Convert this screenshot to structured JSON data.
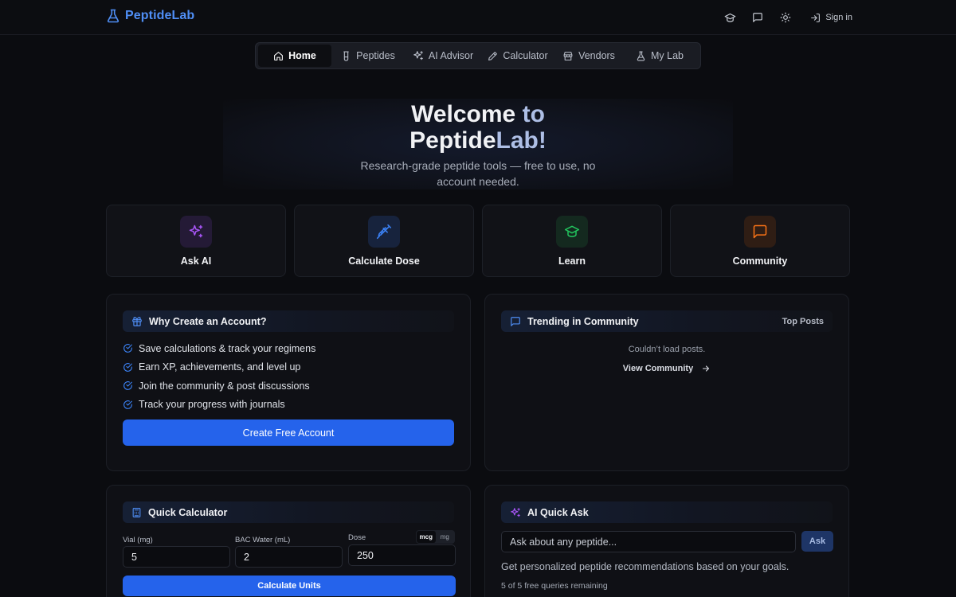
{
  "header": {
    "brand": "PeptideLab",
    "icons": [
      "learn-icon",
      "community-icon",
      "theme-icon"
    ],
    "signin_label": "Sign in"
  },
  "nav": {
    "items": [
      {
        "label": "Home",
        "icon": "home-icon",
        "active": true
      },
      {
        "label": "Peptides",
        "icon": "vial-icon",
        "active": false
      },
      {
        "label": "AI Advisor",
        "icon": "sparkles-icon",
        "active": false
      },
      {
        "label": "Calculator",
        "icon": "pen-icon",
        "active": false
      },
      {
        "label": "Vendors",
        "icon": "store-icon",
        "active": false
      },
      {
        "label": "My Lab",
        "icon": "flask-icon",
        "active": false
      }
    ]
  },
  "hero": {
    "title_prefix": "Welcome",
    "title_to": " to",
    "title_brand_a": "Peptide",
    "title_brand_b": "Lab!",
    "subtitle": "Research-grade peptide tools — free to use, no account needed."
  },
  "quick_actions": [
    {
      "label": "Ask AI",
      "icon": "sparkles-icon",
      "color": "#a855f7"
    },
    {
      "label": "Calculate Dose",
      "icon": "syringe-icon",
      "color": "#3b82f6"
    },
    {
      "label": "Learn",
      "icon": "graduation-cap-icon",
      "color": "#22c55e"
    },
    {
      "label": "Community",
      "icon": "message-icon",
      "color": "#f97316"
    }
  ],
  "account_panel": {
    "title": "Why Create an Account?",
    "benefits": [
      "Save calculations & track your regimens",
      "Earn XP, achievements, and level up",
      "Join the community & post discussions",
      "Track your progress with journals"
    ],
    "cta_label": "Create Free Account"
  },
  "community_panel": {
    "title": "Trending in Community",
    "right_label": "Top Posts",
    "error_text": "Couldn’t load posts.",
    "view_label": "View Community"
  },
  "calculator_panel": {
    "title": "Quick Calculator",
    "vial_label": "Vial (mg)",
    "vial_value": "5",
    "water_label": "BAC Water (mL)",
    "water_value": "2",
    "dose_label": "Dose",
    "dose_value": "250",
    "units": [
      "mcg",
      "mg"
    ],
    "selected_unit": "mcg",
    "button_label": "Calculate Units"
  },
  "ai_panel": {
    "title": "AI Quick Ask",
    "placeholder": "Ask about any peptide...",
    "ask_label": "Ask",
    "description": "Get personalized peptide recommendations based on your goals.",
    "quota": "5 of 5 free queries remaining"
  },
  "colors": {
    "accent": "#2563eb",
    "brand": "#4f8ef5",
    "background": "#0b0c10"
  }
}
